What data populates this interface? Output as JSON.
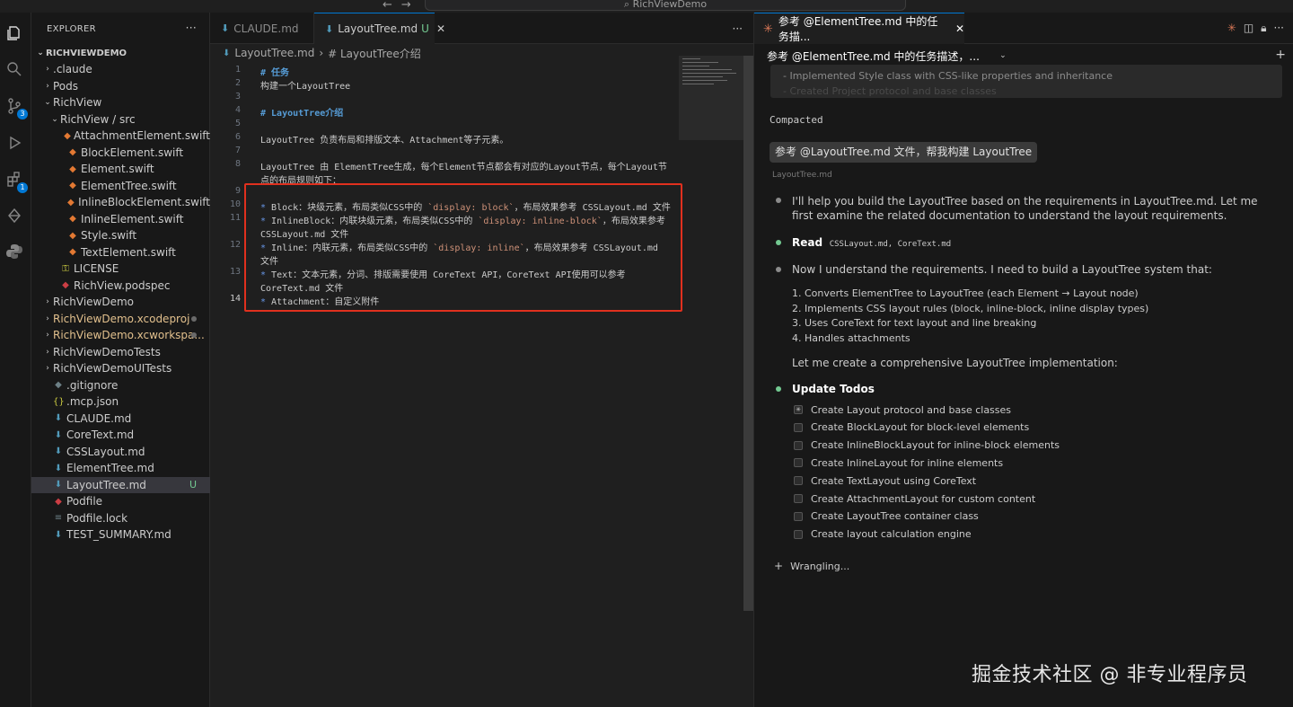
{
  "titlebar": {
    "search": "RichViewDemo"
  },
  "activity_badges": {
    "source_control": "3",
    "extensions": "1"
  },
  "explorer": {
    "header": "EXPLORER",
    "root": "RICHVIEWDEMO",
    "items": [
      {
        "label": ".claude",
        "kind": "folder",
        "depth": 1,
        "expanded": false
      },
      {
        "label": "Pods",
        "kind": "folder",
        "depth": 1,
        "expanded": false
      },
      {
        "label": "RichView",
        "kind": "folder",
        "depth": 1,
        "expanded": true
      },
      {
        "label": "RichView / src",
        "kind": "folder",
        "depth": 2,
        "expanded": true
      },
      {
        "label": "AttachmentElement.swift",
        "kind": "swift",
        "depth": 3
      },
      {
        "label": "BlockElement.swift",
        "kind": "swift",
        "depth": 3
      },
      {
        "label": "Element.swift",
        "kind": "swift",
        "depth": 3
      },
      {
        "label": "ElementTree.swift",
        "kind": "swift",
        "depth": 3
      },
      {
        "label": "InlineBlockElement.swift",
        "kind": "swift",
        "depth": 3
      },
      {
        "label": "InlineElement.swift",
        "kind": "swift",
        "depth": 3
      },
      {
        "label": "Style.swift",
        "kind": "swift",
        "depth": 3
      },
      {
        "label": "TextElement.swift",
        "kind": "swift",
        "depth": 3
      },
      {
        "label": "LICENSE",
        "kind": "license",
        "depth": 2
      },
      {
        "label": "RichView.podspec",
        "kind": "ruby",
        "depth": 2
      },
      {
        "label": "RichViewDemo",
        "kind": "folder",
        "depth": 1,
        "expanded": false
      },
      {
        "label": "RichViewDemo.xcodeproj",
        "kind": "folder",
        "depth": 1,
        "expanded": false,
        "modified": true
      },
      {
        "label": "RichViewDemo.xcworkspa...",
        "kind": "folder",
        "depth": 1,
        "expanded": false,
        "modified": true
      },
      {
        "label": "RichViewDemoTests",
        "kind": "folder",
        "depth": 1,
        "expanded": false
      },
      {
        "label": "RichViewDemoUITests",
        "kind": "folder",
        "depth": 1,
        "expanded": false
      },
      {
        "label": ".gitignore",
        "kind": "git",
        "depth": 1
      },
      {
        "label": ".mcp.json",
        "kind": "json",
        "depth": 1
      },
      {
        "label": "CLAUDE.md",
        "kind": "md",
        "depth": 1
      },
      {
        "label": "CoreText.md",
        "kind": "md",
        "depth": 1
      },
      {
        "label": "CSSLayout.md",
        "kind": "md",
        "depth": 1
      },
      {
        "label": "ElementTree.md",
        "kind": "md",
        "depth": 1
      },
      {
        "label": "LayoutTree.md",
        "kind": "md",
        "depth": 1,
        "selected": true,
        "status": "U"
      },
      {
        "label": "Podfile",
        "kind": "ruby",
        "depth": 1
      },
      {
        "label": "Podfile.lock",
        "kind": "lock",
        "depth": 1
      },
      {
        "label": "TEST_SUMMARY.md",
        "kind": "md",
        "depth": 1
      }
    ]
  },
  "editor": {
    "tabs": [
      {
        "label": "CLAUDE.md",
        "active": false
      },
      {
        "label": "LayoutTree.md",
        "active": true,
        "status": "U"
      }
    ],
    "breadcrumb": {
      "file": "LayoutTree.md",
      "symbol": "# LayoutTree介绍"
    },
    "current_line": 14,
    "lines": [
      {
        "n": "1",
        "text": "# 任务",
        "style": "heading"
      },
      {
        "n": "2",
        "text": "构建一个LayoutTree",
        "style": "plain"
      },
      {
        "n": "3",
        "text": "",
        "style": "plain"
      },
      {
        "n": "4",
        "text": "# LayoutTree介绍",
        "style": "heading"
      },
      {
        "n": "5",
        "text": "",
        "style": "plain"
      },
      {
        "n": "6",
        "text": "LayoutTree 负责布局和排版文本、Attachment等子元素。",
        "style": "plain"
      },
      {
        "n": "7",
        "text": "",
        "style": "plain"
      },
      {
        "n": "8",
        "text": "LayoutTree 由 ElementTree生成，每个Element节点都会有对应的Layout节点，每个Layout节",
        "style": "plain"
      },
      {
        "n": "",
        "text": "点的布局规则如下：",
        "style": "plain"
      },
      {
        "n": "9",
        "text": "",
        "style": "plain"
      },
      {
        "n": "10",
        "parts": [
          "* ",
          "Block：块级元素，布局类似CSS中的 ",
          "`display: block`",
          "，布局效果参考 CSSLayout.md 文件"
        ]
      },
      {
        "n": "11",
        "parts": [
          "* ",
          "InlineBlock：内联块级元素，布局类似CSS中的 ",
          "`display: inline-block`",
          "，布局效果参考"
        ]
      },
      {
        "n": "",
        "text": "CSSLayout.md 文件",
        "style": "plain"
      },
      {
        "n": "12",
        "parts": [
          "* ",
          "Inline：内联元素，布局类似CSS中的 ",
          "`display: inline`",
          "，布局效果参考 CSSLayout.md"
        ]
      },
      {
        "n": "",
        "text": "文件",
        "style": "plain"
      },
      {
        "n": "13",
        "parts": [
          "* ",
          "Text：文本元素，分词、排版需要使用 CoreText API，CoreText API使用可以参考",
          "",
          ""
        ]
      },
      {
        "n": "",
        "text": "CoreText.md 文件",
        "style": "plain"
      },
      {
        "n": "14",
        "parts": [
          "* ",
          "Attachment：自定义附件",
          "",
          ""
        ]
      }
    ]
  },
  "chat": {
    "tab_label": "参考 @ElementTree.md 中的任务描...",
    "session_title": "参考 @ElementTree.md 中的任务描述，...",
    "previous": {
      "line1": "- Implemented Style class with CSS-like properties and inheritance",
      "line2": "- Created Project protocol and base classes"
    },
    "compacted": "Compacted",
    "user_message": "参考 @LayoutTree.md 文件，帮我构建 LayoutTree",
    "user_ref": "LayoutTree.md",
    "intro": "I'll help you build the LayoutTree based on the requirements in LayoutTree.md. Let me first examine the related documentation to understand the layout requirements.",
    "read_label": "Read",
    "read_files": "CSSLayout.md, CoreText.md",
    "understand": "Now I understand the requirements. I need to build a LayoutTree system that:",
    "requirements": [
      "1. Converts ElementTree to LayoutTree (each Element → Layout node)",
      "2. Implements CSS layout rules (block, inline-block, inline display types)",
      "3. Uses CoreText for text layout and line breaking",
      "4. Handles attachments"
    ],
    "create_line": "Let me create a comprehensive LayoutTree implementation:",
    "update_todos": "Update Todos",
    "todos": [
      {
        "label": "Create Layout protocol and base classes",
        "state": "in-progress"
      },
      {
        "label": "Create BlockLayout for block-level elements",
        "state": "pending"
      },
      {
        "label": "Create InlineBlockLayout for inline-block elements",
        "state": "pending"
      },
      {
        "label": "Create InlineLayout for inline elements",
        "state": "pending"
      },
      {
        "label": "Create TextLayout using CoreText",
        "state": "pending"
      },
      {
        "label": "Create AttachmentLayout for custom content",
        "state": "pending"
      },
      {
        "label": "Create LayoutTree container class",
        "state": "pending"
      },
      {
        "label": "Create layout calculation engine",
        "state": "pending"
      }
    ],
    "status": "Wrangling..."
  },
  "watermark": "掘金技术社区 @ 非专业程序员",
  "colors": {
    "accent": "#0078d4",
    "highlight_box": "#e0301e",
    "claude": "#d97757"
  }
}
